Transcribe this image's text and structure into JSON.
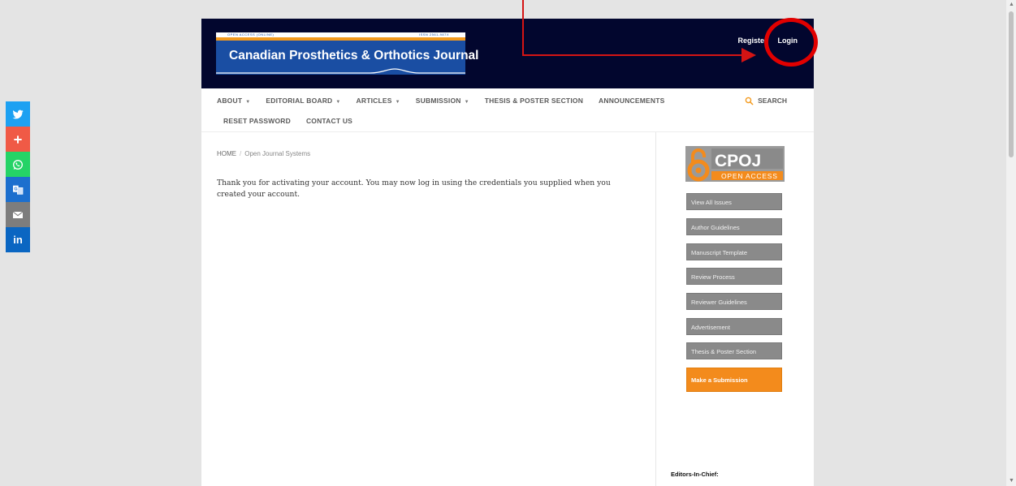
{
  "header": {
    "logo": {
      "strip_left": "OPEN ACCESS (ONLINE)",
      "strip_right": "ISSN 2561-987X",
      "title": "Canadian Prosthetics & Orthotics Journal"
    },
    "user_links": {
      "register": "Registe",
      "login": "Login"
    }
  },
  "nav": {
    "row1": [
      {
        "label": "ABOUT",
        "dropdown": true
      },
      {
        "label": "EDITORIAL BOARD",
        "dropdown": true
      },
      {
        "label": "ARTICLES",
        "dropdown": true
      },
      {
        "label": "SUBMISSION",
        "dropdown": true
      },
      {
        "label": "THESIS & POSTER SECTION",
        "dropdown": false
      },
      {
        "label": "ANNOUNCEMENTS",
        "dropdown": false
      }
    ],
    "row2": [
      {
        "label": "RESET PASSWORD"
      },
      {
        "label": "CONTACT US"
      }
    ],
    "search_label": "SEARCH",
    "caret": "▼"
  },
  "breadcrumb": {
    "home": "HOME",
    "sep": "/",
    "current": "Open Journal Systems"
  },
  "main": {
    "message": "Thank you for activating your account. You may now log in using the credentials you supplied when you created your account."
  },
  "sidebar": {
    "cpoj_logo": {
      "letters": "CPOJ",
      "tagline": "OPEN ACCESS"
    },
    "buttons": [
      "View All Issues",
      "Author Guidelines",
      "Manuscript Template",
      "Review Process",
      "Reviewer Guidelines",
      "Advertisement",
      "Thesis & Poster Section"
    ],
    "submit_button": "Make a Submission",
    "editors_heading": "Editors-In-Chief:"
  },
  "share_bar": {
    "icons": [
      "twitter-icon",
      "plus-icon",
      "whatsapp-icon",
      "translate-icon",
      "email-icon",
      "linkedin-icon"
    ],
    "colors": [
      "#1da1f2",
      "#f05a46",
      "#25d366",
      "#1c6fce",
      "#7d7d7d",
      "#0a66c2"
    ],
    "linkedin_text": "in"
  },
  "colors": {
    "header_bg": "#02062e",
    "accent_orange": "#f38b1c",
    "annotation_red": "#e10000",
    "sidebar_button": "#8a8a8a"
  }
}
